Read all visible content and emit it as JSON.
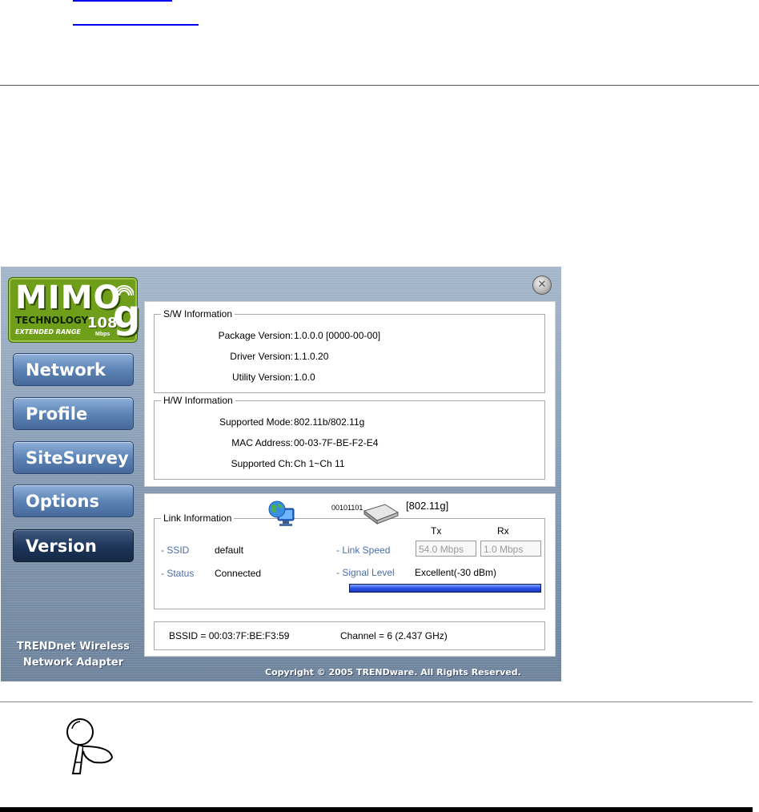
{
  "window": {
    "close_icon": "close-x-icon",
    "logo": {
      "word": "MIMO",
      "technology": "TECHNOLOGY",
      "extended": "EXTENDED RANGE",
      "speed": "108",
      "unit": "Mbps",
      "g": "g"
    },
    "nav": [
      {
        "label": "Network",
        "active": false
      },
      {
        "label": "Profile",
        "active": false
      },
      {
        "label": "SiteSurvey",
        "active": false
      },
      {
        "label": "Options",
        "active": false
      },
      {
        "label": "Version",
        "active": true
      }
    ],
    "brand_line1": "TRENDnet Wireless",
    "brand_line2": "Network Adapter",
    "copyright": "Copyright © 2005 TRENDware. All Rights Reserved."
  },
  "sw_info": {
    "title": "S/W Information",
    "rows": [
      {
        "label": "Package Version:",
        "value": "1.0.0.0 [0000-00-00]"
      },
      {
        "label": "Driver Version:",
        "value": "1.1.0.20"
      },
      {
        "label": "Utility Version:",
        "value": "1.0.0"
      }
    ]
  },
  "hw_info": {
    "title": "H/W Information",
    "rows": [
      {
        "label": "Supported Mode:",
        "value": "802.11b/802.11g"
      },
      {
        "label": "MAC Address:",
        "value": "00-03-7F-BE-F2-E4"
      },
      {
        "label": "Supported Ch:",
        "value": "Ch 1~Ch 11"
      }
    ]
  },
  "link_info": {
    "title": "Link Information",
    "binary": "00101101",
    "mode": "[802.11g]",
    "ssid_label": "- SSID",
    "ssid_value": "default",
    "status_label": "- Status",
    "status_value": "Connected",
    "tx_label": "Tx",
    "rx_label": "Rx",
    "link_speed_label": "- Link Speed",
    "tx_value": "54.0 Mbps",
    "rx_value": "1.0 Mbps",
    "signal_label": "- Signal Level",
    "signal_value": "Excellent(-30 dBm)",
    "signal_fraction": 1.0,
    "globe_icon": "network-globe-icon",
    "adapter_icon": "wireless-adapter-icon"
  },
  "footer": {
    "bssid": "BSSID = 00:03:7F:BE:F3:59",
    "channel": "Channel = 6 (2.437 GHz)"
  },
  "note_icon": "magnifier-note-icon"
}
